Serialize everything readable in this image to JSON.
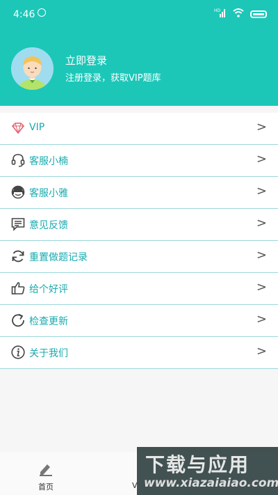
{
  "status_bar": {
    "time": "4:46",
    "network_label": "HD"
  },
  "profile": {
    "title": "立即登录",
    "subtitle": "注册登录，获取VIP题库"
  },
  "menu": [
    {
      "icon": "diamond-icon",
      "label": "VIP",
      "arrow": ">"
    },
    {
      "icon": "headset-icon",
      "label": "客服小楠",
      "arrow": ">"
    },
    {
      "icon": "support-agent-icon",
      "label": "客服小雅",
      "arrow": ">"
    },
    {
      "icon": "feedback-icon",
      "label": "意见反馈",
      "arrow": ">"
    },
    {
      "icon": "refresh-icon",
      "label": "重置做题记录",
      "arrow": ">"
    },
    {
      "icon": "thumbs-up-icon",
      "label": "给个好评",
      "arrow": ">"
    },
    {
      "icon": "update-icon",
      "label": "检查更新",
      "arrow": ">"
    },
    {
      "icon": "info-icon",
      "label": "关于我们",
      "arrow": ">"
    }
  ],
  "bottom_nav": {
    "home_label": "首页",
    "vip_label": "V"
  },
  "watermark": {
    "title": "下载与应用",
    "url": "www.xiazaiaiao.com"
  },
  "colors": {
    "header": "#1cc7b8",
    "menu_text": "#19aab0",
    "divider": "#9ad7d9"
  }
}
